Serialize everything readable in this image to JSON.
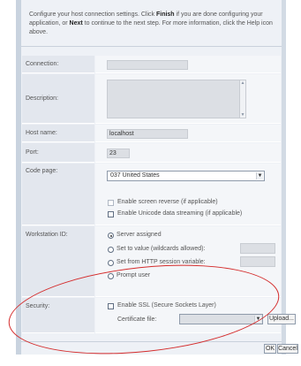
{
  "intro": {
    "part1": "Configure your host connection settings. Click ",
    "finish": "Finish",
    "part2": " if you are done configuring your application, or ",
    "next": "Next",
    "part3": " to continue to the next step. For more information, click the Help icon above."
  },
  "form": {
    "connection_label": "Connection:",
    "connection_value": "",
    "description_label": "Description:",
    "description_value": "",
    "hostname_label": "Host name:",
    "hostname_value": "localhost",
    "port_label": "Port:",
    "port_value": "23",
    "codepage_label": "Code page:",
    "codepage_value": "037 United States",
    "screen_reverse_label": "Enable screen reverse (if applicable)",
    "unicode_label": "Enable Unicode data streaming (if applicable)",
    "workstation_label": "Workstation ID:",
    "ws_option_server": "Server assigned",
    "ws_option_value": "Set to value (wildcards allowed):",
    "ws_option_http": "Set from HTTP session variable:",
    "ws_option_prompt": "Prompt user",
    "security_label": "Security:",
    "ssl_label": "Enable SSL (Secure Sockets Layer)",
    "cert_label": "Certificate file:",
    "cert_value": "",
    "upload_label": "Upload..."
  },
  "footer": {
    "ok_label": "OK",
    "cancel_label": "Cancel"
  },
  "colors": {
    "highlight_ellipse": "#d42b2b"
  }
}
